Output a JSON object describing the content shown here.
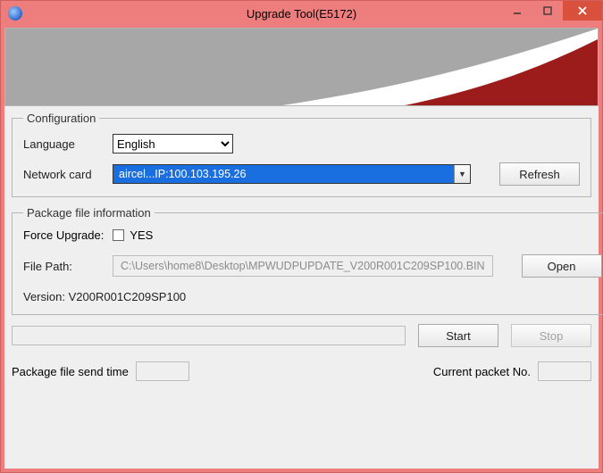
{
  "window": {
    "title": "Upgrade Tool(E5172)"
  },
  "config": {
    "legend": "Configuration",
    "language_label": "Language",
    "language_value": "English",
    "network_label": "Network card",
    "network_value": "aircel...IP:100.103.195.26",
    "refresh_label": "Refresh"
  },
  "package": {
    "legend": "Package file information",
    "force_label": "Force Upgrade:",
    "force_yes": "YES",
    "filepath_label": "File Path:",
    "filepath_value": "C:\\Users\\home8\\Desktop\\MPWUDPUPDATE_V200R001C209SP100.BIN",
    "open_label": "Open",
    "version_label": "Version:",
    "version_value": "V200R001C209SP100"
  },
  "actions": {
    "start_label": "Start",
    "stop_label": "Stop"
  },
  "stats": {
    "send_time_label": "Package file send time",
    "send_time_value": "",
    "packet_no_label": "Current packet No.",
    "packet_no_value": ""
  }
}
